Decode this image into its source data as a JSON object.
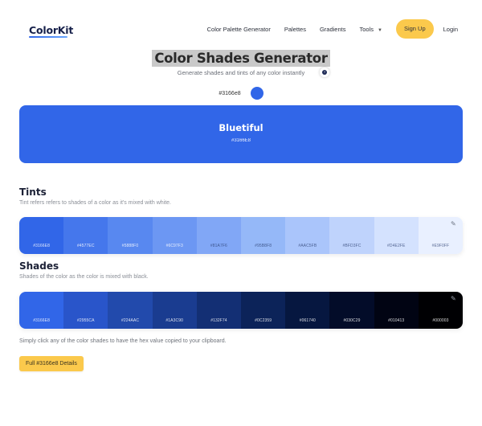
{
  "header": {
    "logo": "ColorKit",
    "nav": [
      {
        "label": "Color Palette Generator"
      },
      {
        "label": "Palettes"
      },
      {
        "label": "Gradients"
      },
      {
        "label": "Tools",
        "icon": "chevron-down-icon"
      }
    ],
    "signup_label": "Sign Up",
    "login_label": "Login",
    "accent": "#fbc94c"
  },
  "page": {
    "title": "Color Shades Generator",
    "subtitle": "Generate shades and tints of any color instantly",
    "picker_value": "#3166e8",
    "picker_color": "#3166e8"
  },
  "hero": {
    "name": "Bluetiful",
    "hex": "#3166E8",
    "color": "#3166e8"
  },
  "tints": {
    "title": "Tints",
    "description": "Tint refers refers to shades of a color as it's mixed with white.",
    "colors": [
      "#3166E8",
      "#4577EC",
      "#5888F0",
      "#6C97F3",
      "#81A7F6",
      "#95B8F8",
      "#AAC5FB",
      "#BFD3FC",
      "#D4E2FE",
      "#E9F0FF"
    ]
  },
  "shades": {
    "title": "Shades",
    "description": "Shades of the color as the color is mixed with black.",
    "colors": [
      "#3166E8",
      "#2955CA",
      "#224AAC",
      "#1A3C90",
      "#132F74",
      "#0C2359",
      "#061740",
      "#030C29",
      "#010413",
      "#000003"
    ]
  },
  "footer": {
    "hint": "Simply click any of the color shades to have the hex value copied to your clipboard.",
    "details_button": "Full #3166e8 Details"
  }
}
